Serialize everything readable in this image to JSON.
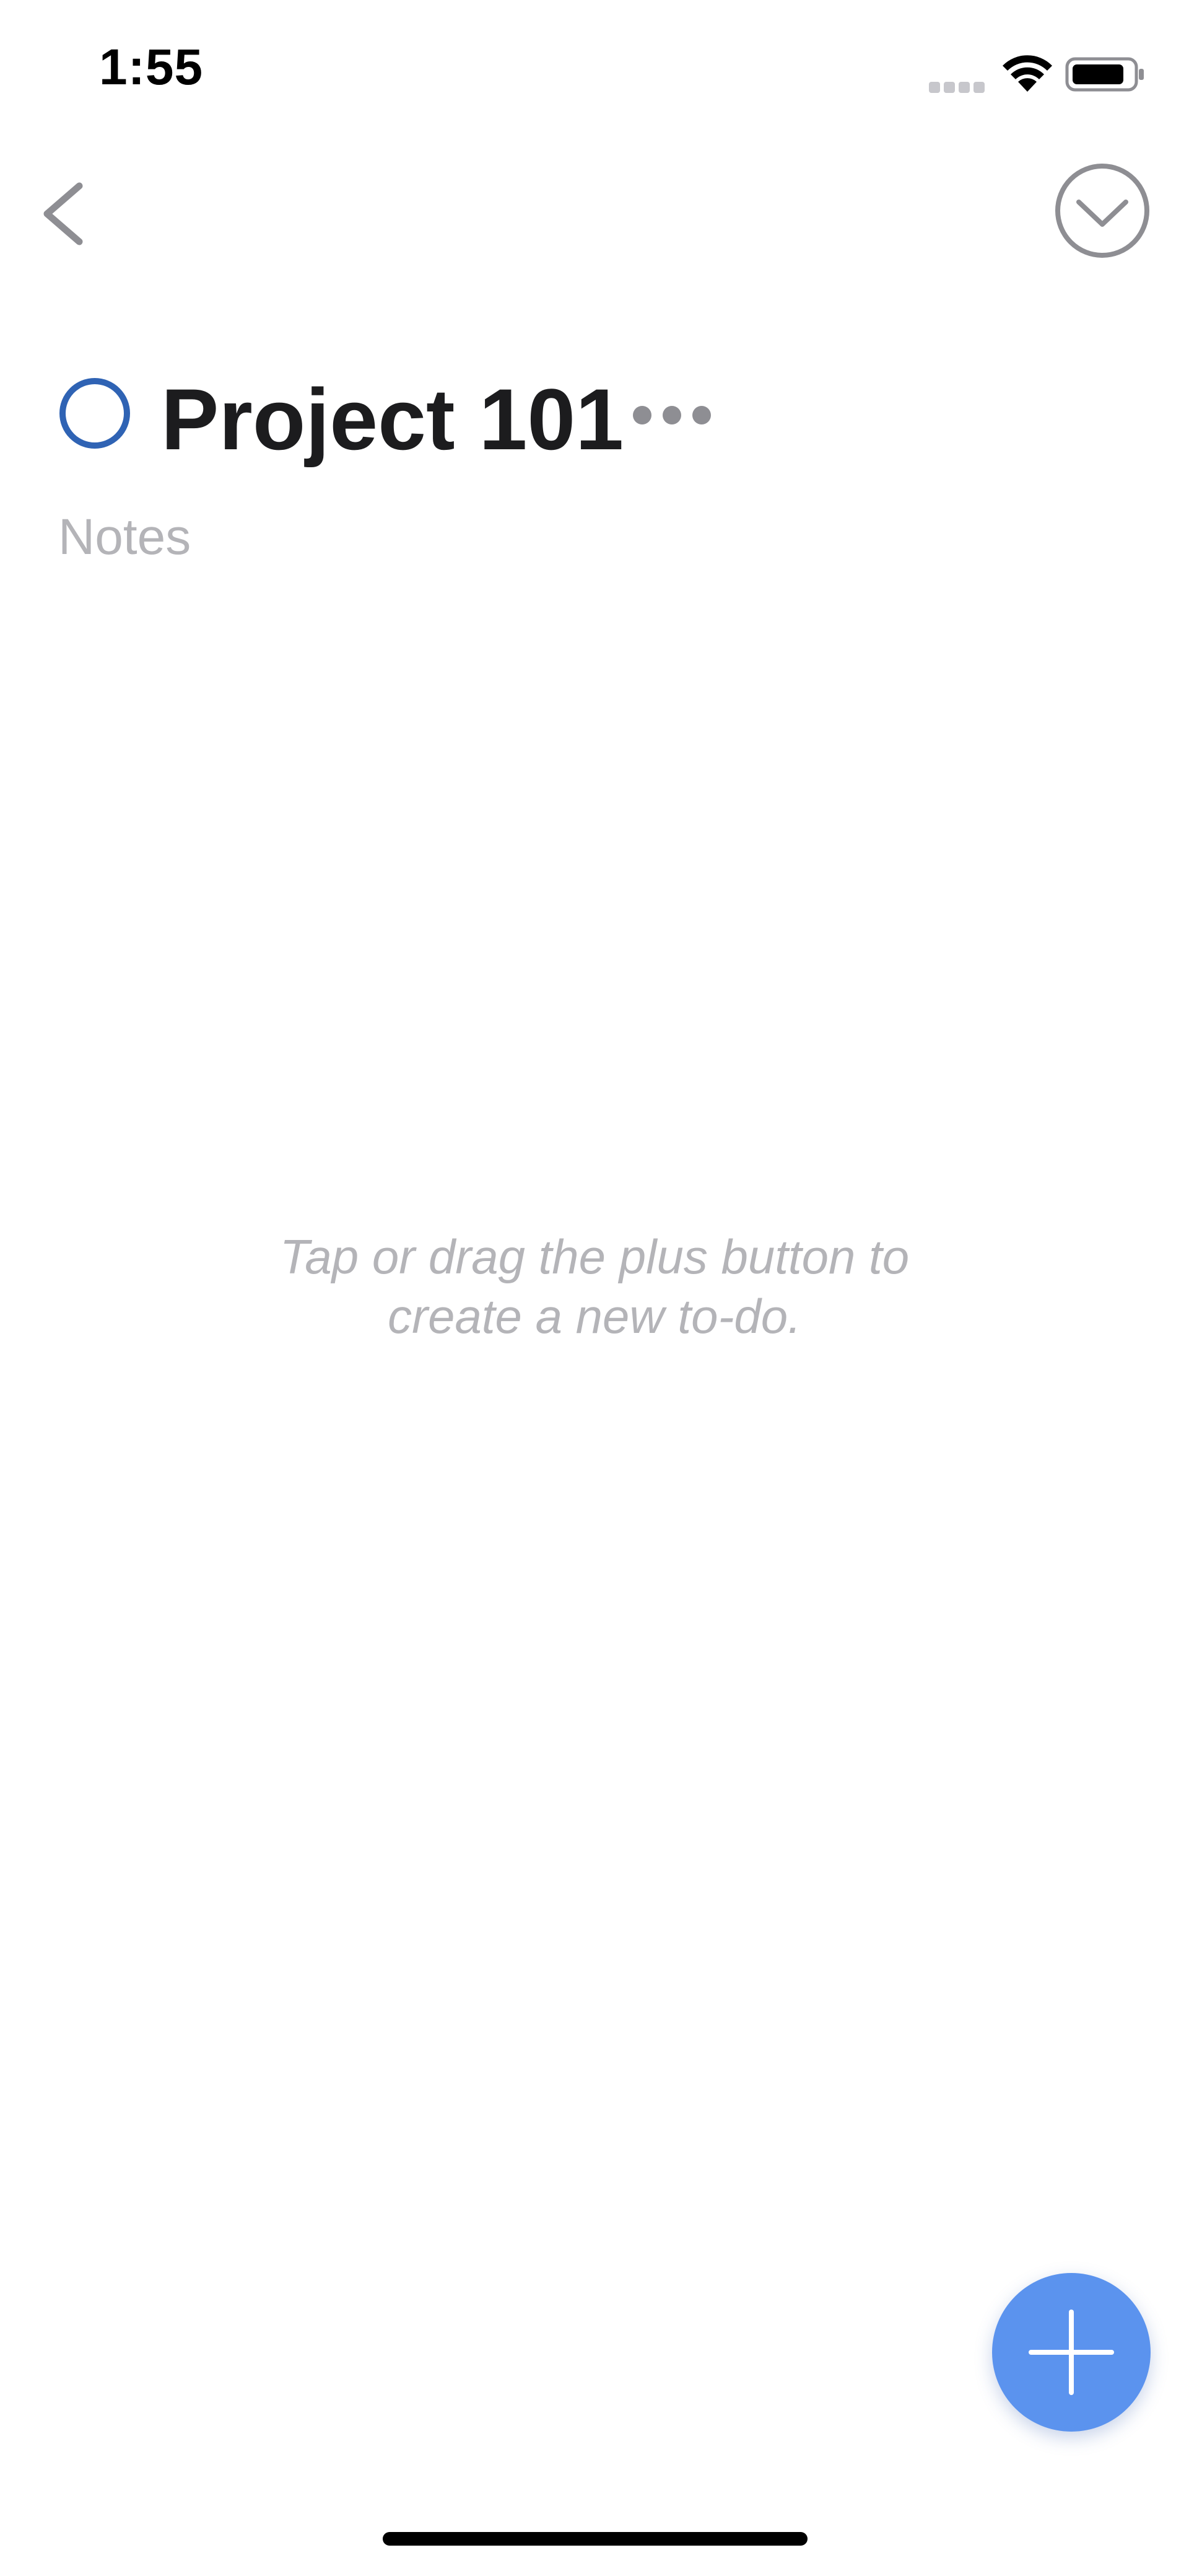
{
  "status_bar": {
    "time": "1:55",
    "signal_icon": "cellular-signal-icon",
    "wifi_icon": "wifi-icon",
    "battery_icon": "battery-icon"
  },
  "nav": {
    "back_icon": "chevron-left-icon",
    "done_icon": "circle-checkmark-icon"
  },
  "project": {
    "title": "Project 101",
    "notes_placeholder": "Notes",
    "accent_color": "#2f63b4"
  },
  "empty_state": {
    "line1": "Tap or drag the plus button to",
    "line2": "create a new to-do."
  },
  "fab": {
    "icon": "plus-icon",
    "color": "#5b93ee"
  }
}
